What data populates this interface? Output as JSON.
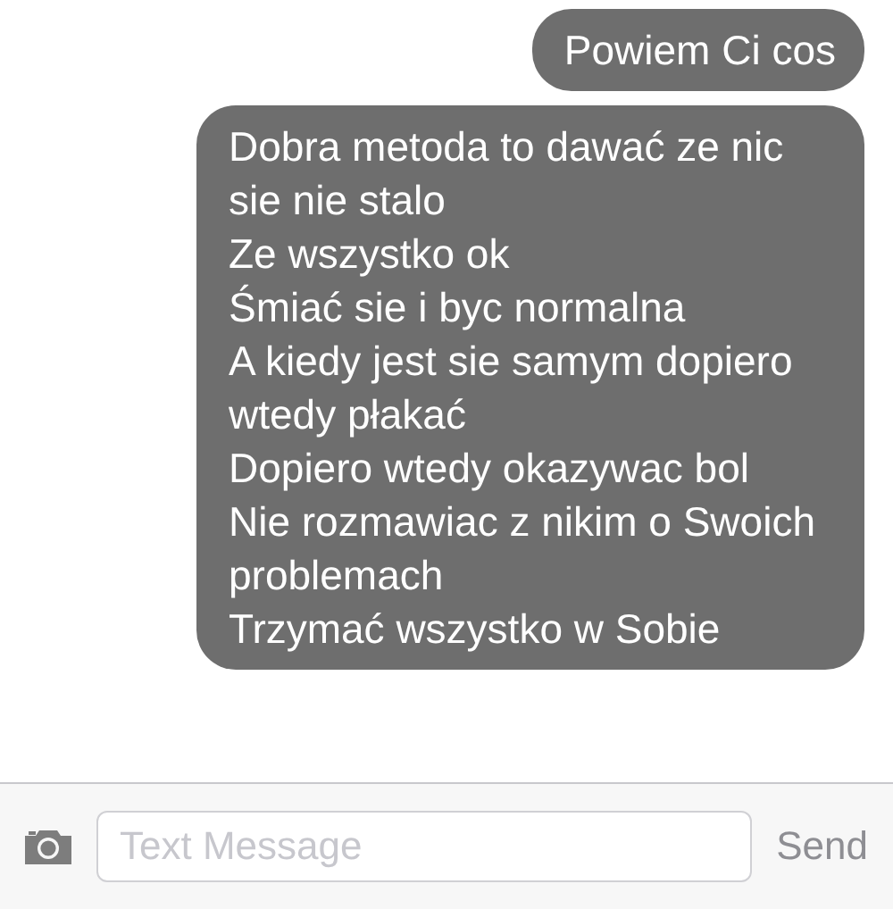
{
  "messages": [
    {
      "text": "Powiem Ci cos"
    },
    {
      "text": "Dobra metoda to dawać ze nic sie nie stalo\nZe wszystko ok\nŚmiać sie i byc normalna\nA kiedy jest sie samym dopiero wtedy płakać\nDopiero wtedy okazywac bol\nNie rozmawiac z nikim o Swoich problemach\nTrzymać wszystko w Sobie"
    }
  ],
  "composer": {
    "placeholder": "Text Message",
    "send": "Send"
  }
}
